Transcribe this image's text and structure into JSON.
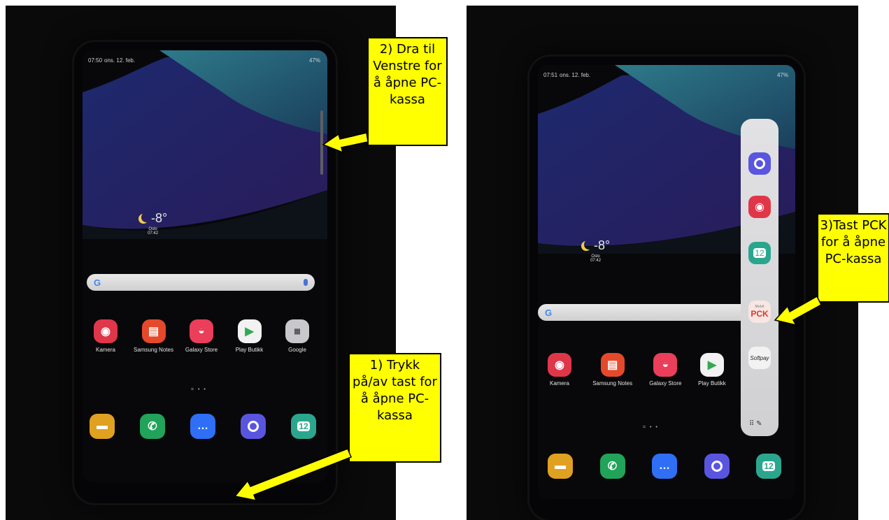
{
  "left": {
    "status_time": "07:50",
    "status_date": "ons. 12. feb.",
    "status_right": "47%",
    "weather": {
      "temp": "-8°",
      "city": "Oslo",
      "time": "07:42"
    },
    "apps": [
      "Kamera",
      "Samsung Notes",
      "Galaxy Store",
      "Play Butikk",
      "Google"
    ],
    "dots": "= • •",
    "callout_swipe": "2) Dra til Venstre for å åpne PC-kassa",
    "callout_power": "1) Trykk på/av tast for å åpne PC-kassa"
  },
  "right": {
    "status_time": "07:51",
    "status_date": "ons. 12. feb.",
    "status_right": "47%",
    "weather": {
      "temp": "-8°",
      "city": "Oslo",
      "time": "07:42"
    },
    "apps": [
      "Kamera",
      "Samsung Notes",
      "Galaxy Store",
      "Play Butikk"
    ],
    "dots": "= • •",
    "edge_panel": {
      "pck_label": "PCK",
      "pck_small": "Mobil",
      "softpay_label": "Softpay"
    },
    "callout_pck": "3)Tast PCK for å åpne PC-kassa"
  },
  "google_letter": "G",
  "calendar_day": "12",
  "colors": {
    "callout": "#ffff00",
    "arrow": "#ffff00"
  }
}
